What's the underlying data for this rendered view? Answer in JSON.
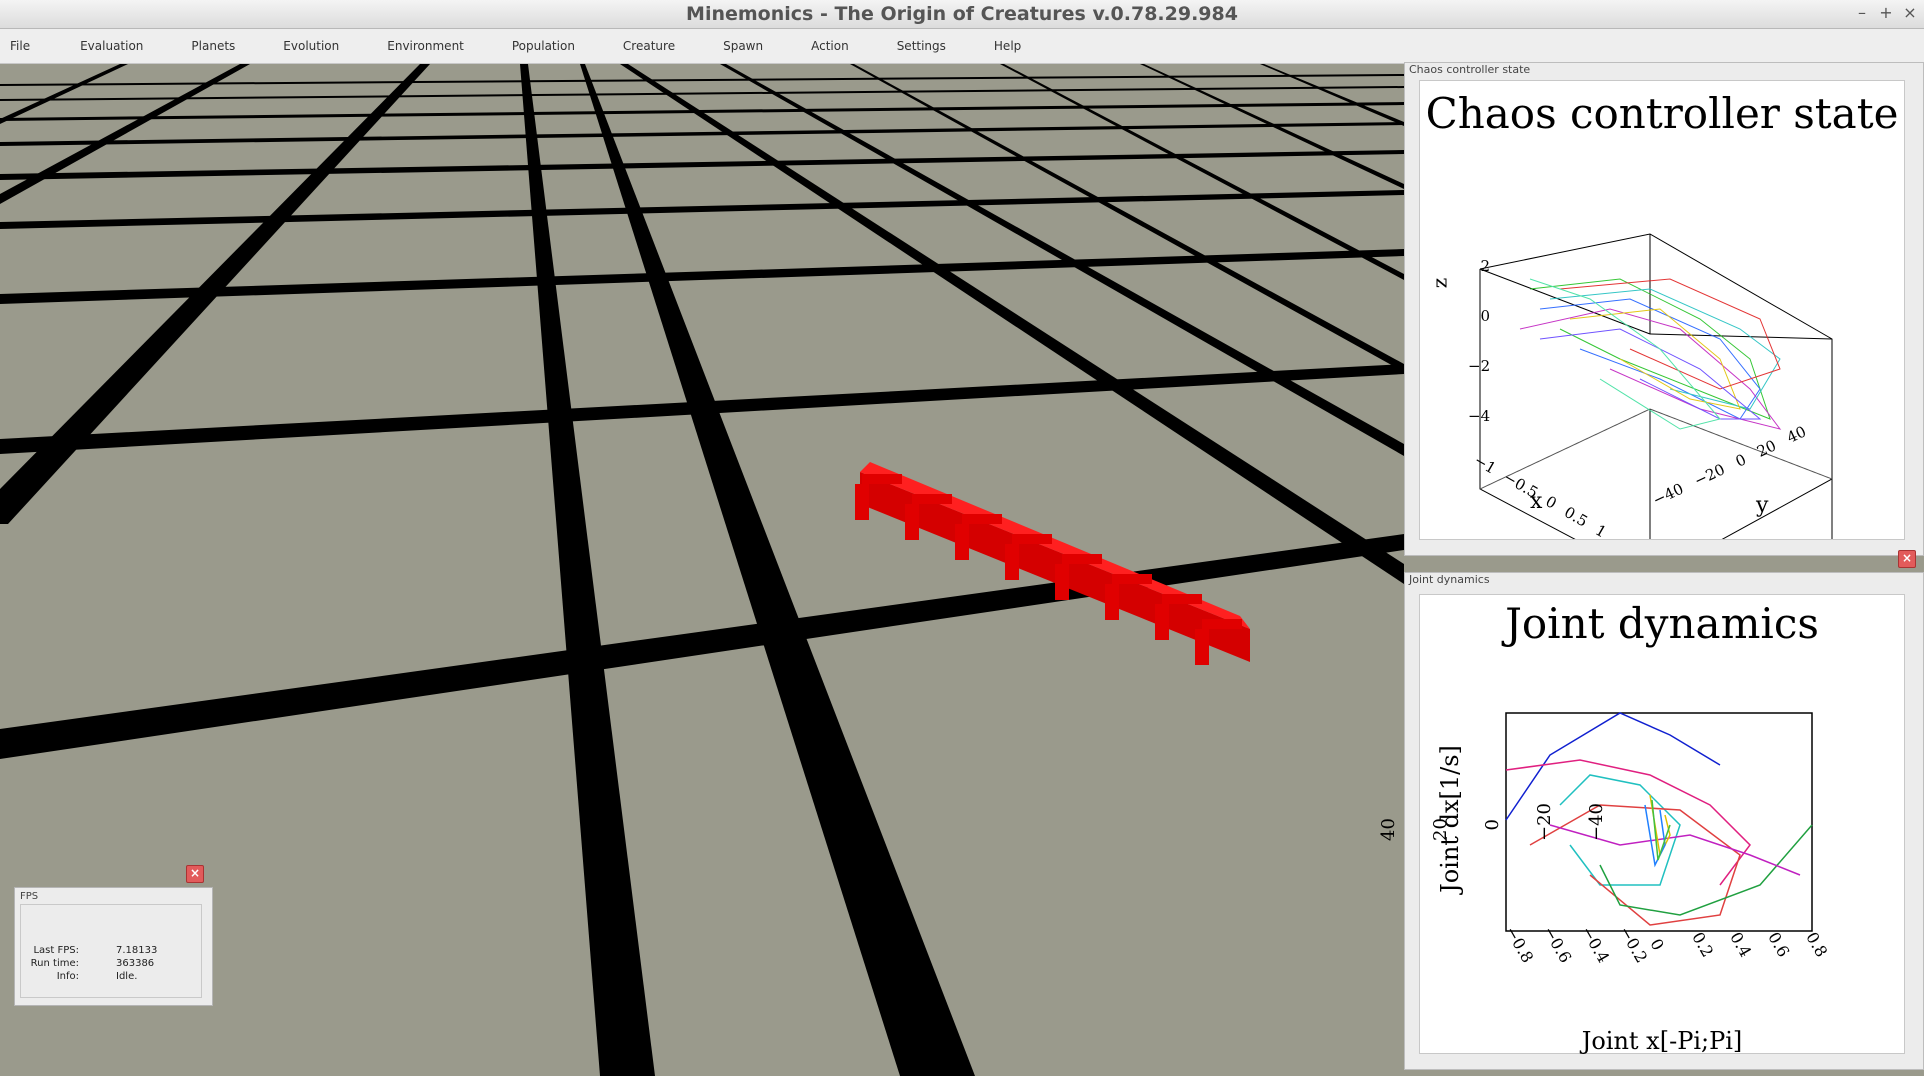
{
  "window": {
    "title": "Minemonics - The Origin of Creatures v.0.78.29.984"
  },
  "menu": [
    "File",
    "Evaluation",
    "Planets",
    "Evolution",
    "Environment",
    "Population",
    "Creature",
    "Spawn",
    "Action",
    "Settings",
    "Help"
  ],
  "chaos_panel": {
    "window_title": "Chaos controller state",
    "plot_title": "Chaos controller state",
    "x_label": "x",
    "y_label": "y",
    "z_label": "z",
    "z_ticks": [
      "2",
      "0",
      "−2",
      "−4"
    ],
    "x_ticks": [
      "−1",
      "−0.5",
      "0",
      "0.5",
      "1"
    ],
    "y_ticks": [
      "−40",
      "−20",
      "0",
      "20",
      "40"
    ]
  },
  "joint_panel": {
    "window_title": "Joint dynamics",
    "plot_title": "Joint dynamics",
    "x_label": "Joint x[-Pi;Pi]",
    "y_label": "Joint dx[1/s]",
    "y_ticks": [
      "40",
      "20",
      "0",
      "−20",
      "−40"
    ],
    "x_ticks": [
      "−0.8",
      "−0.6",
      "−0.4",
      "−0.2",
      "0",
      "0.2",
      "0.4",
      "0.6",
      "0.8"
    ]
  },
  "fps_panel": {
    "title": "FPS",
    "last_fps_label": "Last FPS:",
    "last_fps_value": "7.18133",
    "run_time_label": "Run time:",
    "run_time_value": "363386",
    "info_label": "Info:",
    "info_value": "Idle."
  },
  "colors": {
    "ground": "#9a9a8c",
    "grid_line": "#000000",
    "creature": "#e00000"
  }
}
